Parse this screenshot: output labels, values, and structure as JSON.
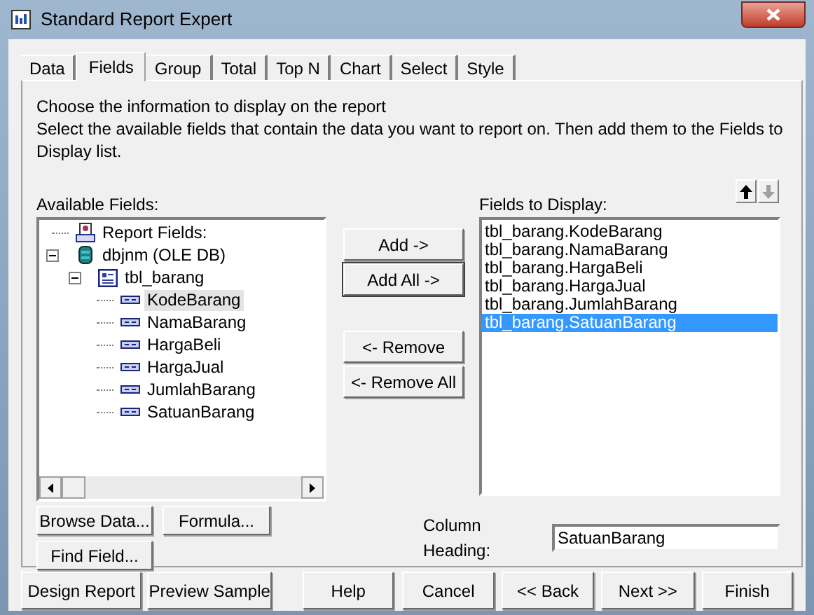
{
  "window": {
    "title": "Standard Report Expert"
  },
  "tabs": [
    {
      "label": "Data",
      "selected": false
    },
    {
      "label": "Fields",
      "selected": true
    },
    {
      "label": "Group",
      "selected": false
    },
    {
      "label": "Total",
      "selected": false
    },
    {
      "label": "Top N",
      "selected": false
    },
    {
      "label": "Chart",
      "selected": false
    },
    {
      "label": "Select",
      "selected": false
    },
    {
      "label": "Style",
      "selected": false
    }
  ],
  "instructions": [
    "Choose the information to display on the report",
    "Select the available fields that contain the data you want to report on.  Then add them to the Fields to Display list."
  ],
  "available_fields": {
    "label": "Available Fields:",
    "tree": [
      {
        "label": "Report Fields:",
        "kind": "report",
        "selected": false
      },
      {
        "label": "dbjnm (OLE DB)",
        "kind": "database",
        "selected": false,
        "expanded": true,
        "children": [
          {
            "label": "tbl_barang",
            "kind": "table",
            "selected": false,
            "expanded": true,
            "children": [
              {
                "label": "KodeBarang",
                "kind": "field",
                "selected": true
              },
              {
                "label": "NamaBarang",
                "kind": "field",
                "selected": false
              },
              {
                "label": "HargaBeli",
                "kind": "field",
                "selected": false
              },
              {
                "label": "HargaJual",
                "kind": "field",
                "selected": false
              },
              {
                "label": "JumlahBarang",
                "kind": "field",
                "selected": false
              },
              {
                "label": "SatuanBarang",
                "kind": "field",
                "selected": false
              }
            ]
          }
        ]
      }
    ]
  },
  "move_buttons": [
    {
      "label": "Add ->",
      "focused": false
    },
    {
      "label": "Add All ->",
      "focused": true
    },
    {
      "label": "<- Remove",
      "focused": false
    },
    {
      "label": "<- Remove All",
      "focused": false
    }
  ],
  "fields_to_display": {
    "label": "Fields to Display:",
    "items": [
      {
        "label": "tbl_barang.KodeBarang",
        "selected": false
      },
      {
        "label": "tbl_barang.NamaBarang",
        "selected": false
      },
      {
        "label": "tbl_barang.HargaBeli",
        "selected": false
      },
      {
        "label": "tbl_barang.HargaJual",
        "selected": false
      },
      {
        "label": "tbl_barang.JumlahBarang",
        "selected": false
      },
      {
        "label": "tbl_barang.SatuanBarang",
        "selected": true
      }
    ]
  },
  "left_buttons": [
    "Browse Data...",
    "Formula...",
    "Find Field..."
  ],
  "column_heading": {
    "label": "Column Heading:",
    "value": "SatuanBarang"
  },
  "footer_buttons": [
    "Design Report",
    "Preview Sample",
    "Help",
    "Cancel",
    "<< Back",
    "Next >>",
    "Finish"
  ]
}
